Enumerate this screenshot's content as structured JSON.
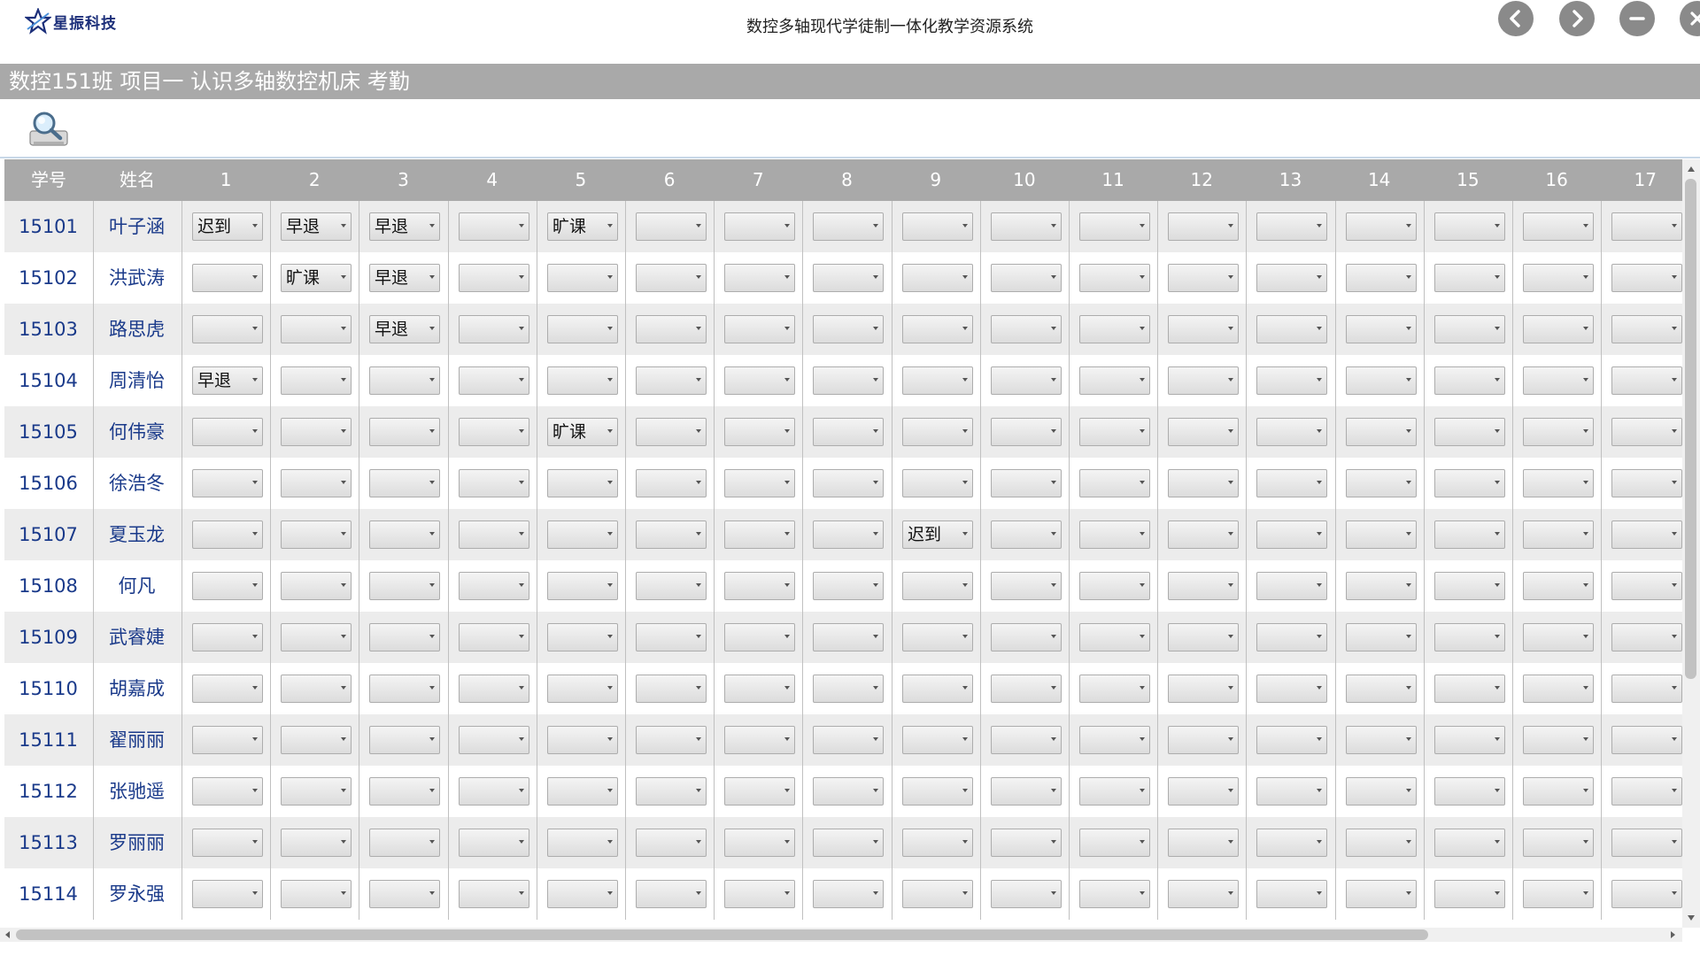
{
  "app": {
    "logo_text": "星振科技",
    "title": "数控多轴现代学徒制一体化教学资源系统"
  },
  "section": {
    "title": "数控151班 项目一 认识多轴数控机床 考勤"
  },
  "colors": {
    "header_gray": "#a9a9a9",
    "row_alt": "#ececec",
    "text_blue": "#1a3a8a",
    "button_gray": "#8a8a8a"
  },
  "table": {
    "headers": [
      "学号",
      "姓名",
      "1",
      "2",
      "3",
      "4",
      "5",
      "6",
      "7",
      "8",
      "9",
      "10",
      "11",
      "12",
      "13",
      "14",
      "15",
      "16",
      "17"
    ],
    "rows": [
      {
        "id": "15101",
        "name": "叶子涵",
        "marks": [
          "迟到",
          "早退",
          "早退",
          "",
          "旷课",
          "",
          "",
          "",
          "",
          "",
          "",
          "",
          "",
          "",
          "",
          "",
          ""
        ]
      },
      {
        "id": "15102",
        "name": "洪武涛",
        "marks": [
          "",
          "旷课",
          "早退",
          "",
          "",
          "",
          "",
          "",
          "",
          "",
          "",
          "",
          "",
          "",
          "",
          "",
          ""
        ]
      },
      {
        "id": "15103",
        "name": "路思虎",
        "marks": [
          "",
          "",
          "早退",
          "",
          "",
          "",
          "",
          "",
          "",
          "",
          "",
          "",
          "",
          "",
          "",
          "",
          ""
        ]
      },
      {
        "id": "15104",
        "name": "周清怡",
        "marks": [
          "早退",
          "",
          "",
          "",
          "",
          "",
          "",
          "",
          "",
          "",
          "",
          "",
          "",
          "",
          "",
          "",
          ""
        ]
      },
      {
        "id": "15105",
        "name": "何伟豪",
        "marks": [
          "",
          "",
          "",
          "",
          "旷课",
          "",
          "",
          "",
          "",
          "",
          "",
          "",
          "",
          "",
          "",
          "",
          ""
        ]
      },
      {
        "id": "15106",
        "name": "徐浩冬",
        "marks": [
          "",
          "",
          "",
          "",
          "",
          "",
          "",
          "",
          "",
          "",
          "",
          "",
          "",
          "",
          "",
          "",
          ""
        ]
      },
      {
        "id": "15107",
        "name": "夏玉龙",
        "marks": [
          "",
          "",
          "",
          "",
          "",
          "",
          "",
          "",
          "迟到",
          "",
          "",
          "",
          "",
          "",
          "",
          "",
          ""
        ]
      },
      {
        "id": "15108",
        "name": "何凡",
        "marks": [
          "",
          "",
          "",
          "",
          "",
          "",
          "",
          "",
          "",
          "",
          "",
          "",
          "",
          "",
          "",
          "",
          ""
        ]
      },
      {
        "id": "15109",
        "name": "武睿婕",
        "marks": [
          "",
          "",
          "",
          "",
          "",
          "",
          "",
          "",
          "",
          "",
          "",
          "",
          "",
          "",
          "",
          "",
          ""
        ]
      },
      {
        "id": "15110",
        "name": "胡嘉成",
        "marks": [
          "",
          "",
          "",
          "",
          "",
          "",
          "",
          "",
          "",
          "",
          "",
          "",
          "",
          "",
          "",
          "",
          ""
        ]
      },
      {
        "id": "15111",
        "name": "翟丽丽",
        "marks": [
          "",
          "",
          "",
          "",
          "",
          "",
          "",
          "",
          "",
          "",
          "",
          "",
          "",
          "",
          "",
          "",
          ""
        ]
      },
      {
        "id": "15112",
        "name": "张驰遥",
        "marks": [
          "",
          "",
          "",
          "",
          "",
          "",
          "",
          "",
          "",
          "",
          "",
          "",
          "",
          "",
          "",
          "",
          ""
        ]
      },
      {
        "id": "15113",
        "name": "罗丽丽",
        "marks": [
          "",
          "",
          "",
          "",
          "",
          "",
          "",
          "",
          "",
          "",
          "",
          "",
          "",
          "",
          "",
          "",
          ""
        ]
      },
      {
        "id": "15114",
        "name": "罗永强",
        "marks": [
          "",
          "",
          "",
          "",
          "",
          "",
          "",
          "",
          "",
          "",
          "",
          "",
          "",
          "",
          "",
          "",
          ""
        ]
      }
    ]
  },
  "icons": {
    "logo": "star-logo-icon",
    "search": "search-magnifier-icon",
    "back": "chevron-left-icon",
    "forward": "chevron-right-icon",
    "minimize": "minimize-icon",
    "close": "close-icon"
  }
}
